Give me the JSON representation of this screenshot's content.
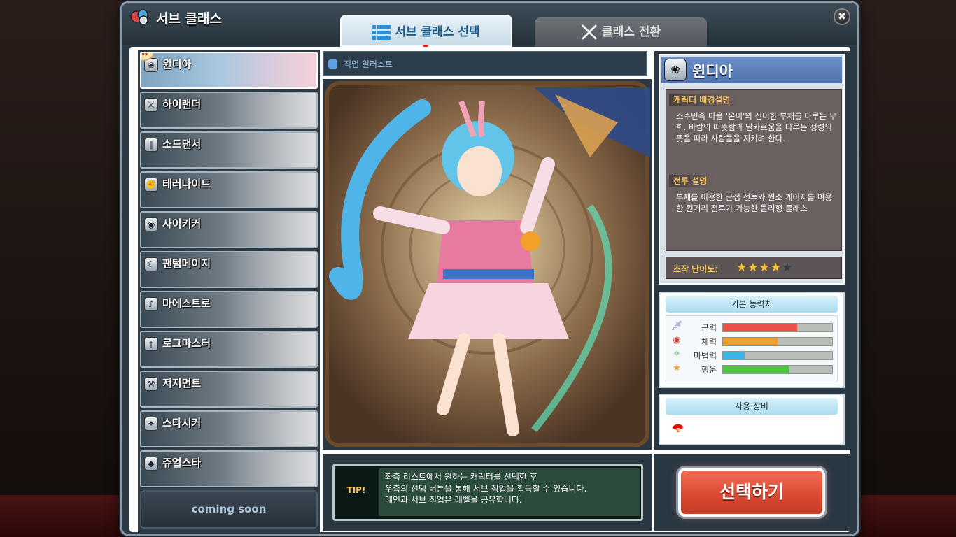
{
  "window": {
    "title": "서브 클래스",
    "close_label": "✖"
  },
  "tabs": [
    {
      "label": "서브 클래스 선택",
      "active": true
    },
    {
      "label": "클래스 전환",
      "active": false
    }
  ],
  "class_list": {
    "new_badge": "NEW",
    "items": [
      {
        "name": "윈디아",
        "selected": true,
        "new": true
      },
      {
        "name": "하이랜더",
        "selected": false,
        "new": false
      },
      {
        "name": "소드댄서",
        "selected": false,
        "new": false
      },
      {
        "name": "테러나이트",
        "selected": false,
        "new": false
      },
      {
        "name": "사이키커",
        "selected": false,
        "new": false
      },
      {
        "name": "팬텀메이지",
        "selected": false,
        "new": false
      },
      {
        "name": "마에스트로",
        "selected": false,
        "new": false
      },
      {
        "name": "로그마스터",
        "selected": false,
        "new": false
      },
      {
        "name": "저지먼트",
        "selected": false,
        "new": false
      },
      {
        "name": "스타시커",
        "selected": false,
        "new": false
      },
      {
        "name": "쥬얼스타",
        "selected": false,
        "new": false
      }
    ],
    "coming_soon": "coming soon"
  },
  "illustration": {
    "header": "직업 일러스트"
  },
  "info": {
    "class_name": "윈디아",
    "background_label": "캐릭터 배경설명",
    "background_text": "소수민족 마을 '온비'의 신비한 부채를 다루는 무희. 바람의 따뜻함과 날카로움을 다루는 정령의 뜻을 따라 사람들을 지키려 한다.",
    "combat_label": "전투 설명",
    "combat_text": "부채를 이용한 근접 전투와 원소 게이지를 이용한 원거리 전투가 가능한 물리형 클래스",
    "difficulty_label": "조작 난이도:",
    "difficulty": 4,
    "difficulty_max": 5
  },
  "stats": {
    "title": "기본 능력치",
    "items": [
      {
        "name": "근력",
        "value": 0.68,
        "color": "#e8524a",
        "icon": "sword-icon"
      },
      {
        "name": "체력",
        "value": 0.5,
        "color": "#f0a030",
        "icon": "shield-icon"
      },
      {
        "name": "마법력",
        "value": 0.2,
        "color": "#3cb4ea",
        "icon": "magic-wand-icon"
      },
      {
        "name": "행운",
        "value": 0.6,
        "color": "#54c244",
        "icon": "star-icon"
      }
    ]
  },
  "equipment": {
    "title": "사용 장비",
    "icon": "fan-weapon-icon"
  },
  "tip": {
    "label": "TIP!",
    "lines": [
      "좌측 리스트에서 원하는 캐릭터를 선택한 후",
      "우측의 선택 버튼을 통해 서브 직업을 획득할 수 있습니다.",
      "메인과 서브 직업은 레벨을 공유합니다."
    ]
  },
  "select_button": "선택하기"
}
